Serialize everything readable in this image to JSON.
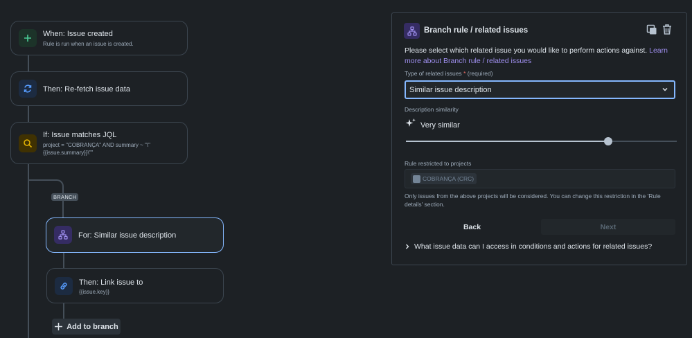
{
  "rule": {
    "nodes": [
      {
        "title": "When: Issue created",
        "subtitle": "Rule is run when an issue is created."
      },
      {
        "title": "Then: Re-fetch issue data"
      },
      {
        "title": "If: Issue matches JQL",
        "subtitle": "project = \"COBRANÇA\" AND summary ~ \"\\\"{{issue.summary}}\\\"\""
      },
      {
        "title": "For: Similar issue description"
      },
      {
        "title": "Then: Link issue to",
        "subtitle": "{{issue.key}}"
      }
    ],
    "branch_tag": "BRANCH",
    "add_to_branch": "Add to branch"
  },
  "panel": {
    "title": "Branch rule / related issues",
    "intro": "Please select which related issue you would like to perform actions against.",
    "learn_more": "Learn more about Branch rule / related issues",
    "type_label": "Type of related issues",
    "required_marker": "*",
    "required_text": "(required)",
    "type_value": "Similar issue description",
    "similarity_label": "Description similarity",
    "similarity_value": "Very similar",
    "similarity_level": 0.746,
    "projects_label": "Rule restricted to projects",
    "project_tag": "COBRANÇA (CRC)",
    "projects_help": "Only issues from the above projects will be considered. You can change this restriction in the 'Rule details' section.",
    "back_label": "Back",
    "next_label": "Next",
    "faq": "What issue data can I access in conditions and actions for related issues?"
  },
  "colors": {
    "background": "#1d2125",
    "accent": "#85b8ff",
    "link": "#9f8fef",
    "trigger_icon_bg": "#1c3329",
    "action_icon_bg": "#1c2b41",
    "condition_icon_bg": "#3f3102",
    "branch_icon_bg": "#352c63"
  },
  "icons": [
    "plus-icon",
    "refresh-icon",
    "search-icon",
    "branch-icon",
    "link-icon",
    "duplicate-icon",
    "trash-icon",
    "sparkle-icon",
    "chevron-down-icon",
    "chevron-right-icon",
    "project-avatar-icon"
  ]
}
